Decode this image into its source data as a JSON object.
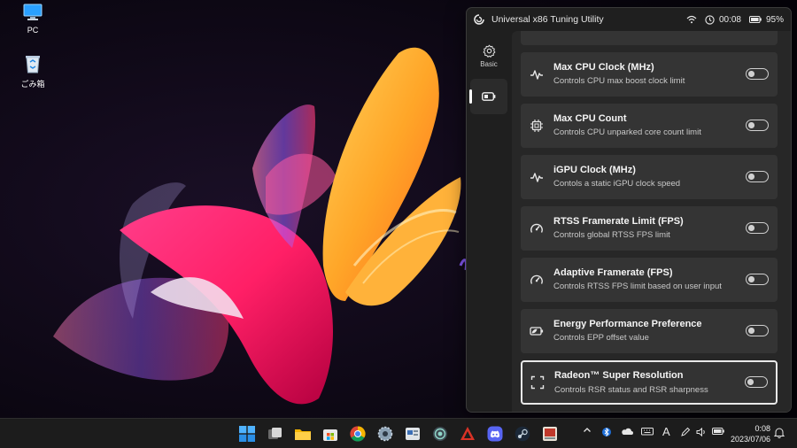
{
  "desktop": {
    "icons": [
      {
        "label": "PC",
        "icon": "monitor-icon"
      },
      {
        "label": "ごみ箱",
        "icon": "recycle-bin-icon"
      }
    ]
  },
  "window": {
    "title": "Universal x86 Tuning Utility",
    "status": {
      "time": "00:08",
      "battery": "95%"
    }
  },
  "nav": {
    "items": [
      {
        "label": "Basic",
        "icon": "gear-icon",
        "active": false
      },
      {
        "label": "",
        "icon": "battery-icon",
        "active": true
      }
    ]
  },
  "settings": [
    {
      "title": "Max CPU Clock (MHz)",
      "description": "Controls CPU max boost clock limit",
      "icon": "pulse-icon",
      "enabled": false
    },
    {
      "title": "Max CPU Count",
      "description": "Controls CPU unparked core count limit",
      "icon": "cpu-icon",
      "enabled": false
    },
    {
      "title": "iGPU Clock (MHz)",
      "description": "Contols a static iGPU clock speed",
      "icon": "pulse-icon",
      "enabled": false
    },
    {
      "title": "RTSS Framerate Limit (FPS)",
      "description": "Controls global RTSS FPS limit",
      "icon": "gauge-icon",
      "enabled": false
    },
    {
      "title": "Adaptive Framerate (FPS)",
      "description": "Controls RTSS FPS limit based on user input",
      "icon": "gauge-icon",
      "enabled": false
    },
    {
      "title": "Energy Performance Preference",
      "description": "Controls EPP offset value",
      "icon": "battery-saver-icon",
      "enabled": false
    },
    {
      "title": "Radeon™ Super Resolution",
      "description": "Controls RSR status and RSR sharpness",
      "icon": "fullscreen-icon",
      "enabled": false
    }
  ],
  "taskbar": {
    "apps": [
      "start-icon",
      "task-view-icon",
      "file-explorer-icon",
      "store-icon",
      "chrome-icon",
      "settings-app-icon",
      "app-icon",
      "app-icon",
      "app-icon",
      "discord-icon",
      "steam-icon",
      "app-icon"
    ],
    "tray": {
      "ime": "A"
    },
    "clock": {
      "time": "0:08",
      "date": "2023/07/06"
    }
  },
  "colors": {
    "window_bg": "#1f1f1f",
    "content_bg": "#272727",
    "card_bg": "#343434",
    "taskbar_bg": "#1c1c1c"
  }
}
